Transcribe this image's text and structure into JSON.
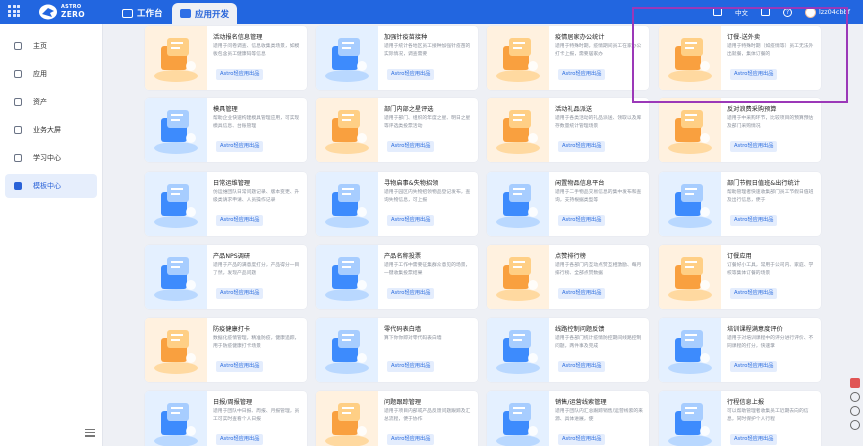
{
  "topbar": {
    "logo_line1": "ASTRO",
    "logo_line2": "ZERO",
    "tabs": [
      {
        "label": "工作台"
      },
      {
        "label": "应用开发"
      }
    ],
    "language": "中文",
    "username": "lzz04cbbf"
  },
  "sidebar": {
    "items": [
      {
        "label": "主页",
        "icon": "home-icon"
      },
      {
        "label": "应用",
        "icon": "app-icon"
      },
      {
        "label": "资产",
        "icon": "assets-icon"
      },
      {
        "label": "业务大屏",
        "icon": "screen-icon"
      },
      {
        "label": "学习中心",
        "icon": "learn-icon"
      },
      {
        "label": "模板中心",
        "icon": "template-icon"
      }
    ],
    "active_index": 5
  },
  "cards": [
    {
      "title": "活动报名信息管理",
      "desc": "适用于问卷调查、信息收集类场景，如模板包含员工健康码等信息",
      "badge": "Astro轻应用出品",
      "theme": "orange"
    },
    {
      "title": "加强针疫苗接种",
      "desc": "适用于统计各地区员工接种加强针疫苗的实际情况，调查需要",
      "badge": "Astro轻应用出品",
      "theme": "blue"
    },
    {
      "title": "疫情居家办公统计",
      "desc": "适用于特殊时期，疫情期间员工在家办公打卡上报，需要居家办",
      "badge": "Astro轻应用出品",
      "theme": "orange"
    },
    {
      "title": "订餐-送外卖",
      "desc": "适用于特殊时期（如疫情等）员工无法外出就餐，集体订餐的",
      "badge": "Astro轻应用出品",
      "theme": "orange"
    },
    {
      "title": "模具管理",
      "desc": "帮助企业快速构建模具管理应用，可实现模具信息、台账管理",
      "badge": "Astro轻应用出品",
      "theme": "blue"
    },
    {
      "title": "部门内部之星评选",
      "desc": "适用于部门、组织的年度之星、明日之星等评选类投票活动",
      "badge": "Astro轻应用出品",
      "theme": "orange"
    },
    {
      "title": "活动礼品派送",
      "desc": "适用于各类活动的礼品派送、领取以及库存数量统计管理场景",
      "badge": "Astro轻应用出品",
      "theme": "orange"
    },
    {
      "title": "反对浪费采购预算",
      "desc": "适用于中采购环节，比较项目的预算预估及部门采购情况",
      "badge": "Astro轻应用出品",
      "theme": "orange"
    },
    {
      "title": "日常运维管理",
      "desc": "仿运维团队日常问题记录、版本变更、升级类请求申请、人员操作记录",
      "badge": "Astro轻应用出品",
      "theme": "blue"
    },
    {
      "title": "寻物启事&失物招领",
      "desc": "适用于园区内失物招领物品登记发布，查询失物信息，可上报",
      "badge": "Astro轻应用出品",
      "theme": "blue"
    },
    {
      "title": "闲置物品信息平台",
      "desc": "适用于二手物品交易信息的集中发布和查询，支持根据类型等",
      "badge": "Astro轻应用出品",
      "theme": "blue"
    },
    {
      "title": "部门节假日值班&出行统计",
      "desc": "帮助管理者快速收集部门员工节假日值班及出行信息，便于",
      "badge": "Astro轻应用出品",
      "theme": "blue"
    },
    {
      "title": "产品NPS调研",
      "desc": "适用于产品的满意度打分，产品得分一目了然，发现产品问题",
      "badge": "Astro轻应用出品",
      "theme": "blue"
    },
    {
      "title": "产品名称投票",
      "desc": "适用于工作中需要征集群众意见的场景，一键收集投票结果",
      "badge": "Astro轻应用出品",
      "theme": "blue"
    },
    {
      "title": "点赞排行榜",
      "desc": "适用于各部门内互动点赞互相激励、每月排行榜、全部点赞数据",
      "badge": "Astro轻应用出品",
      "theme": "orange"
    },
    {
      "title": "订餐应用",
      "desc": "订餐好小工具，常用于公司内、家庭、学校等集体订餐的场景",
      "badge": "Astro轻应用出品",
      "theme": "orange"
    },
    {
      "title": "防疫健康打卡",
      "desc": "数据化疫情管理，精准防疫，健康追踪，用于防疫健康打卡场景",
      "badge": "Astro轻应用出品",
      "theme": "orange"
    },
    {
      "title": "零代码表白墙",
      "desc": "算下你你即对零代码表白墙",
      "badge": "Astro轻应用出品",
      "theme": "blue"
    },
    {
      "title": "线路控制问题反馈",
      "desc": "适用于各部门统计疫情防控期间线路控制问题，两件事及完成",
      "badge": "Astro轻应用出品",
      "theme": "blue"
    },
    {
      "title": "培训课程满意度评价",
      "desc": "适用于对培训课程中的评分进行评价、不同课程的打分，快速掌",
      "badge": "Astro轻应用出品",
      "theme": "blue"
    },
    {
      "title": "日报/周报管理",
      "desc": "适用于团队中日报、周报、月报管理，员工可实时查看个人日报",
      "badge": "Astro轻应用出品",
      "theme": "blue"
    },
    {
      "title": "问题跟踪管理",
      "desc": "适用于项目内部或产品反馈问题跟踪及汇总流程，便于协作",
      "badge": "Astro轻应用出品",
      "theme": "orange"
    },
    {
      "title": "销售/运营线索管理",
      "desc": "适用于团队内汇总跟踪销售/运营线索的来源、具体进展，使",
      "badge": "Astro轻应用出品",
      "theme": "blue"
    },
    {
      "title": "行程信息上报",
      "desc": "可以帮助管理者收集员工近期去向的信息，同时保护个人行程",
      "badge": "Astro轻应用出品",
      "theme": "blue"
    }
  ],
  "colors": {
    "topbar": "#2266e0",
    "accent": "#2a62d7",
    "highlight_border": "#9b38b8",
    "badge_bg": "#e4edfd",
    "badge_text": "#2b6cde"
  }
}
